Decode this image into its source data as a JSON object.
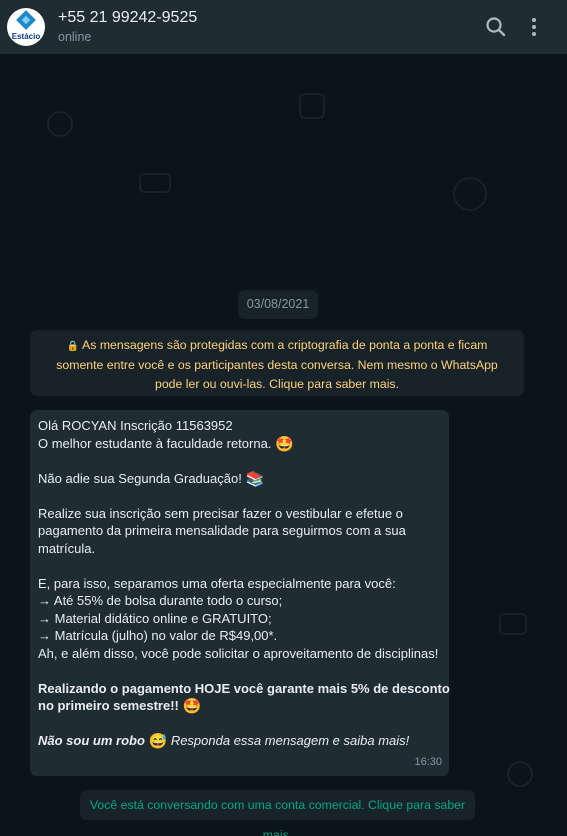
{
  "header": {
    "avatar_brand": "Estácio",
    "title": "+55 21 99242-9525",
    "status": "online",
    "search_icon": "search-icon",
    "menu_icon": "more-vertical-icon"
  },
  "chat": {
    "date": "03/08/2021",
    "encryption_notice": "As mensagens são protegidas com a criptografia de ponta a ponta e ficam somente entre você e os participantes desta conversa. Nem mesmo o WhatsApp pode ler ou ouvi-las. Clique para saber mais.",
    "message": {
      "line1": "Olá ROCYAN   Inscrição 11563952",
      "line2": "O melhor estudante à faculdade retorna.",
      "line3": "Não adie sua Segunda Graduação!",
      "line4": "Realize sua inscrição sem precisar fazer o vestibular e efetue o",
      "line5": "pagamento da primeira mensalidade para seguirmos com a sua",
      "line6": "matrícula.",
      "line7": "E, para isso, separamos uma oferta especialmente para você:",
      "line8": "→ Até 55% de bolsa durante todo o curso;",
      "line9": "→ Material didático online e GRATUITO;",
      "line10": "→ Matrícula (julho) no valor de R$49,00*.",
      "line11": "Ah, e além disso, você pode solicitar o aproveitamento de disciplinas!",
      "line12": "Realizando o pagamento HOJE você garante mais 5% de desconto",
      "line13": "no primeiro semestre!!",
      "line14_bold": "Não sou um robo",
      "line14_italic": " Responda essa mensagem e saiba mais!",
      "emoji_star": "🤩",
      "emoji_books": "📚",
      "emoji_sweat": "😅",
      "time": "16:30"
    },
    "business_notice": "Você está conversando com uma conta comercial. Clique para saber mais."
  }
}
